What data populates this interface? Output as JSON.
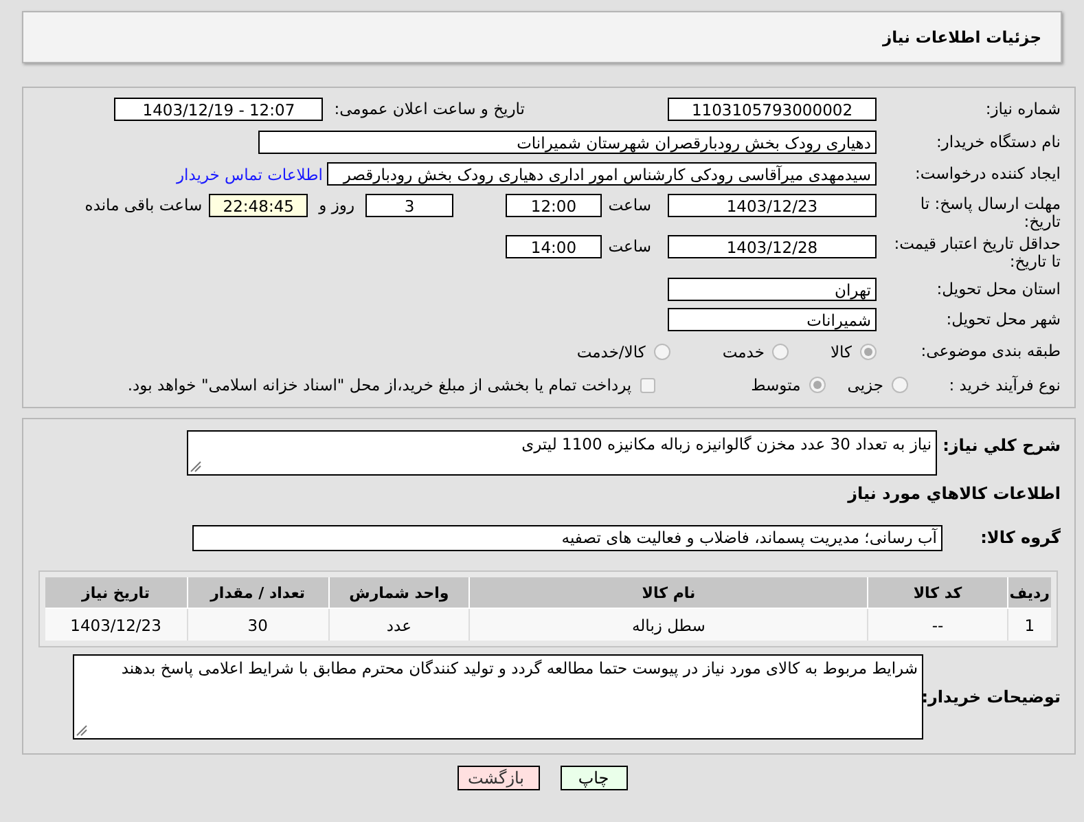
{
  "header": {
    "title": "جزئیات اطلاعات نیاز"
  },
  "details": {
    "need_number": {
      "label": "شماره نیاز:",
      "value": "1103105793000002"
    },
    "announce": {
      "label": "تاریخ و ساعت اعلان عمومی:",
      "value": "1403/12/19 - 12:07"
    },
    "buyer_org": {
      "label": "نام دستگاه خریدار:",
      "value": "دهیاری رودک بخش رودبارقصران شهرستان شمیرانات"
    },
    "requester": {
      "label": "ایجاد کننده درخواست:",
      "value": "سیدمهدی میرآقاسی رودکی کارشناس امور اداری دهیاری رودک بخش رودبارقصر",
      "link": "اطلاعات تماس خریدار"
    },
    "reply_deadline": {
      "label": "مهلت ارسال پاسخ: تا تاریخ:",
      "date": "1403/12/23",
      "time_label": "ساعت",
      "time": "12:00",
      "days": "3",
      "days_label": "روز و",
      "remaining": "22:48:45",
      "remaining_label": "ساعت باقی مانده"
    },
    "price_validity": {
      "label": "حداقل تاریخ اعتبار قیمت: تا تاریخ:",
      "date": "1403/12/28",
      "time_label": "ساعت",
      "time": "14:00"
    },
    "province": {
      "label": "استان محل تحویل:",
      "value": "تهران"
    },
    "city": {
      "label": "شهر محل تحویل:",
      "value": "شمیرانات"
    },
    "category": {
      "label": "طبقه بندی موضوعی:",
      "options": [
        {
          "label": "کالا",
          "selected": true
        },
        {
          "label": "خدمت",
          "selected": false
        },
        {
          "label": "کالا/خدمت",
          "selected": false
        }
      ]
    },
    "purchase_type": {
      "label": "نوع فرآیند خرید :",
      "options": [
        {
          "label": "جزیی",
          "selected": false
        },
        {
          "label": "متوسط",
          "selected": true
        }
      ],
      "payment_note": {
        "label": "پرداخت تمام یا بخشی از مبلغ خرید،از محل \"اسناد خزانه اسلامی\" خواهد بود.",
        "checked": false
      }
    }
  },
  "needs": {
    "description": {
      "label": "شرح کلي نياز:",
      "value": "نیاز به تعداد 30 عدد مخزن گالوانیزه زباله مکانیزه 1100 لیتری"
    },
    "items_heading": "اطلاعات کالاهاي مورد نياز",
    "goods_group": {
      "label": "گروه کالا:",
      "value": "آب رسانی؛ مدیریت پسماند، فاضلاب و فعالیت های تصفیه"
    },
    "table": {
      "columns": [
        "ردیف",
        "کد کالا",
        "نام کالا",
        "واحد شمارش",
        "تعداد / مقدار",
        "تاریخ نیاز"
      ],
      "rows": [
        [
          "1",
          "--",
          "سطل زباله",
          "عدد",
          "30",
          "1403/12/23"
        ]
      ]
    },
    "buyer_notes": {
      "label": "توضیحات خریدار:",
      "value": "شرایط مربوط به کالای مورد نیاز در پیوست حتما مطالعه گردد و تولید کنندگان محترم مطابق با شرایط اعلامی پاسخ بدهند"
    }
  },
  "actions": [
    {
      "label": "چاپ",
      "kind": "print"
    },
    {
      "label": "بازگشت",
      "kind": "back"
    }
  ]
}
